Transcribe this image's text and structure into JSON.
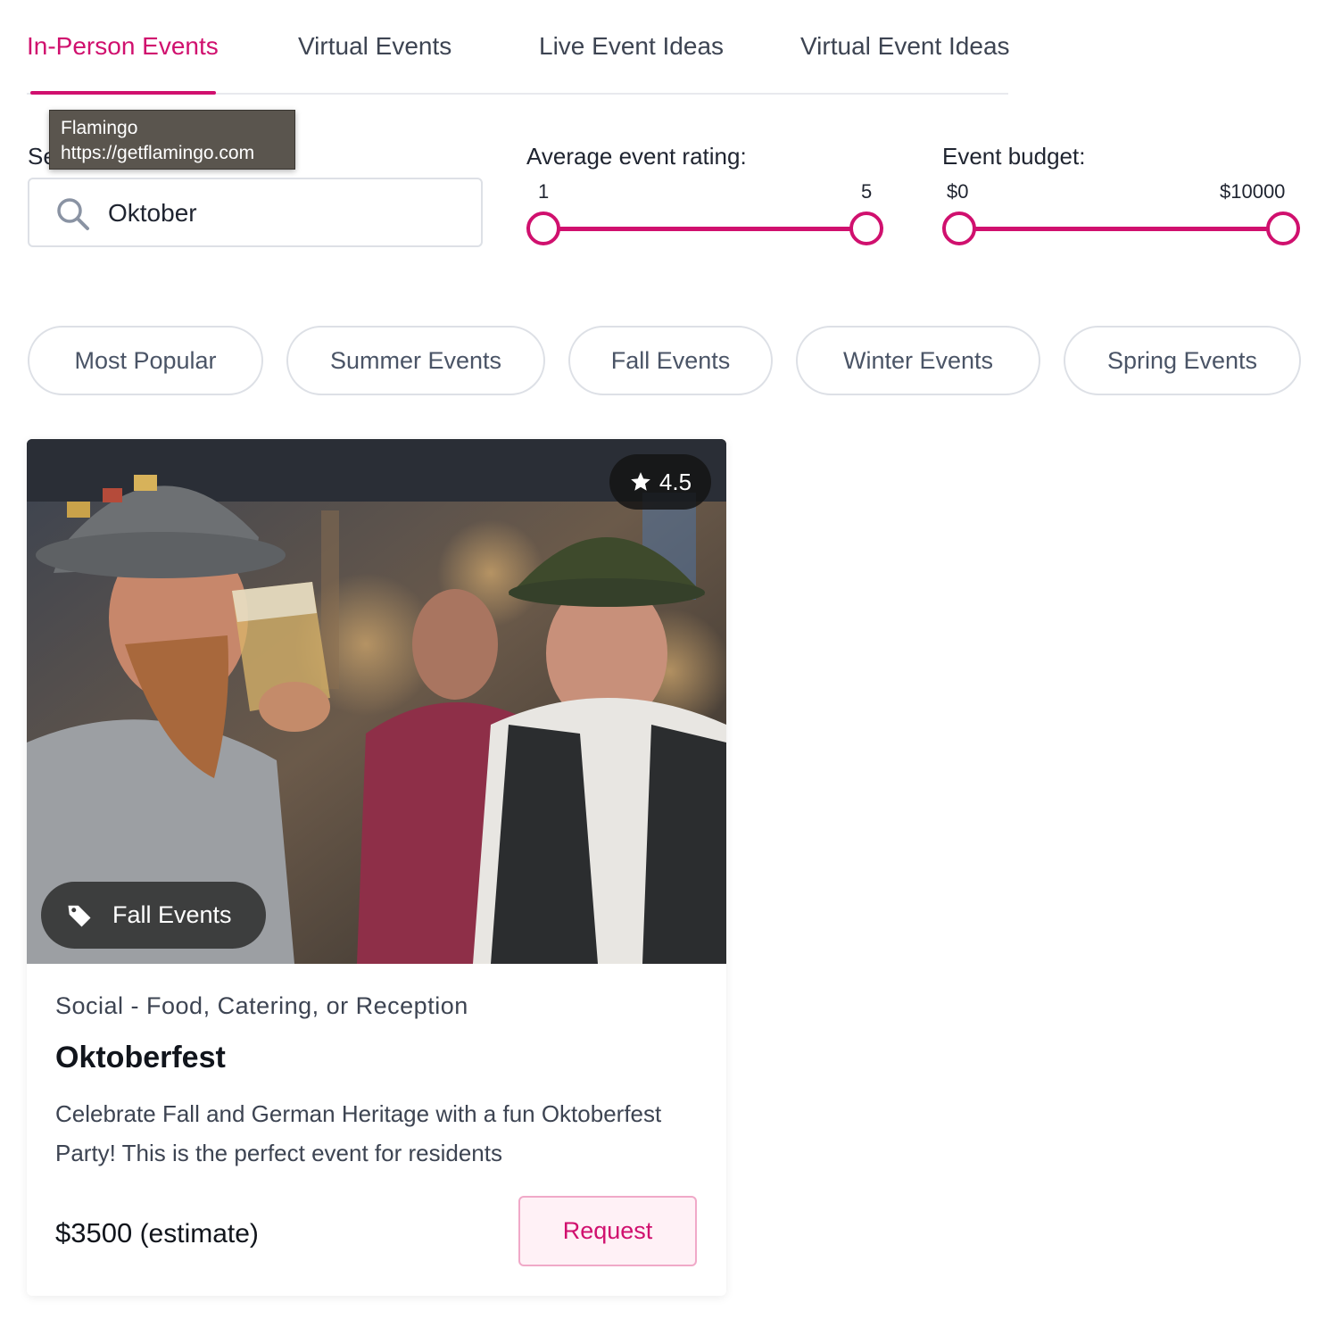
{
  "tabs": [
    {
      "label": "In-Person Events",
      "active": true
    },
    {
      "label": "Virtual Events",
      "active": false
    },
    {
      "label": "Live Event Ideas",
      "active": false
    },
    {
      "label": "Virtual Event Ideas",
      "active": false
    }
  ],
  "tooltip": {
    "title": "Flamingo",
    "url": "https://getflamingo.com"
  },
  "search": {
    "label_visible": "Se",
    "value": "Oktober",
    "icon": "search-icon"
  },
  "rating_filter": {
    "title": "Average event rating:",
    "min_label": "1",
    "max_label": "5",
    "min": 1,
    "max": 5
  },
  "budget_filter": {
    "title": "Event budget:",
    "min_label": "$0",
    "max_label": "$10000",
    "min": 0,
    "max": 10000
  },
  "chips": [
    {
      "label": "Most Popular"
    },
    {
      "label": "Summer Events"
    },
    {
      "label": "Fall Events"
    },
    {
      "label": "Winter Events"
    },
    {
      "label": "Spring Events"
    }
  ],
  "card": {
    "rating": "4.5",
    "tag": "Fall Events",
    "category": "Social - Food, Catering, or Reception",
    "title": "Oktoberfest",
    "description": "Celebrate Fall and German Heritage with a fun Oktoberfest Party! This is the perfect event for residents",
    "price": "$3500",
    "price_note": "(estimate)",
    "request_label": "Request"
  },
  "colors": {
    "accent": "#d0106e",
    "text": "#1f2430",
    "muted": "#4a5466",
    "border": "#dde0e6"
  }
}
